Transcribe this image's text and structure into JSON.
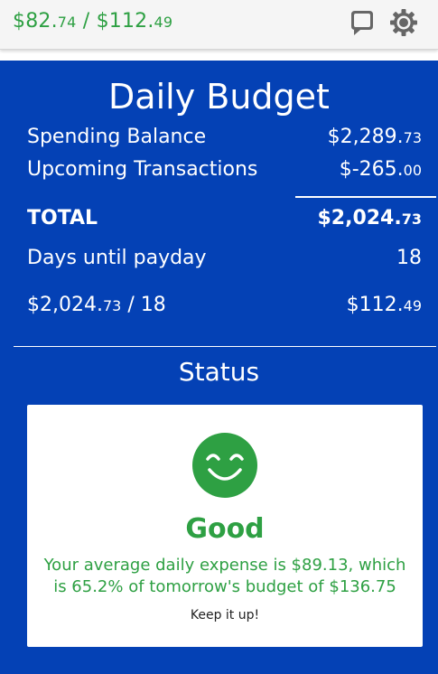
{
  "topbar": {
    "spent_main": "$82.",
    "spent_cents": "74",
    "separator": " / ",
    "budget_main": "$112.",
    "budget_cents": "49",
    "chat_icon": "chat-bubble-icon",
    "settings_icon": "gear-icon"
  },
  "budget": {
    "title": "Daily Budget",
    "spending_balance_label": "Spending Balance",
    "spending_balance_main": "$2,289.",
    "spending_balance_cents": "73",
    "upcoming_label": "Upcoming Transactions",
    "upcoming_main": "$-265.",
    "upcoming_cents": "00",
    "total_label": "TOTAL",
    "total_main": "$2,024.",
    "total_cents": "73",
    "days_label": "Days until payday",
    "days_value": "18",
    "calc_main": "$2,024.",
    "calc_cents": "73",
    "calc_rest": " / 18",
    "daily_main": "$112.",
    "daily_cents": "49"
  },
  "status": {
    "heading": "Status",
    "face_icon": "smiling-face-icon",
    "word": "Good",
    "description": "Your average daily expense is $89.13, which is 65.2% of tomorrow's budget of $136.75",
    "encouragement": "Keep it up!"
  },
  "colors": {
    "primary_blue": "#0441b5",
    "good_green": "#2ea043",
    "topbar_bg": "#f5f5f5"
  }
}
